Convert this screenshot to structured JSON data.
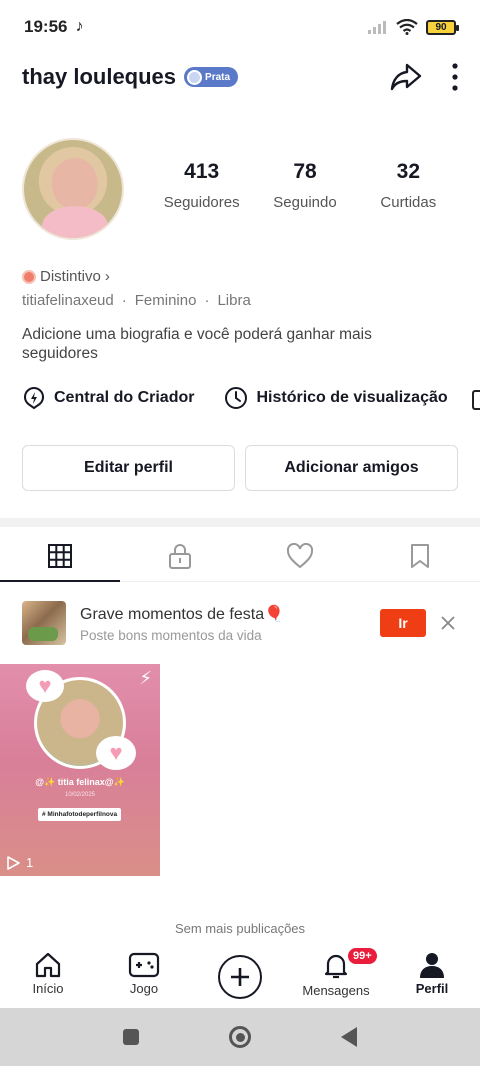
{
  "status": {
    "time": "19:56",
    "battery": "90"
  },
  "header": {
    "username": "thay louleques",
    "badge": "Prata"
  },
  "stats": [
    {
      "num": "413",
      "label": "Seguidores"
    },
    {
      "num": "78",
      "label": "Seguindo"
    },
    {
      "num": "32",
      "label": "Curtidas"
    }
  ],
  "profile": {
    "distintivo": "Distintivo",
    "handle": "titiafelinaxeud",
    "gender": "Feminino",
    "sign": "Libra",
    "bio": "Adicione uma biografia e você poderá ganhar mais seguidores"
  },
  "tools": {
    "creator": "Central do Criador",
    "history": "Histórico de visualização"
  },
  "buttons": {
    "edit": "Editar perfil",
    "add": "Adicionar amigos"
  },
  "promo": {
    "title": "Grave momentos de festa🎈",
    "subtitle": "Poste bons momentos da vida",
    "go": "Ir"
  },
  "video": {
    "caption": "@✨ titia felinax@✨",
    "date": "10/02/2025",
    "tag": "# Minhafotodeperfilnova",
    "plays": "1"
  },
  "feed": {
    "end_text": "Sem mais publicações"
  },
  "nav": {
    "home": "Início",
    "game": "Jogo",
    "messages": "Mensagens",
    "messages_badge": "99+",
    "profile": "Perfil"
  },
  "colors": {
    "accent": "#ef3e14",
    "badge": "#5b79c9",
    "notif": "#ea1d3c"
  }
}
